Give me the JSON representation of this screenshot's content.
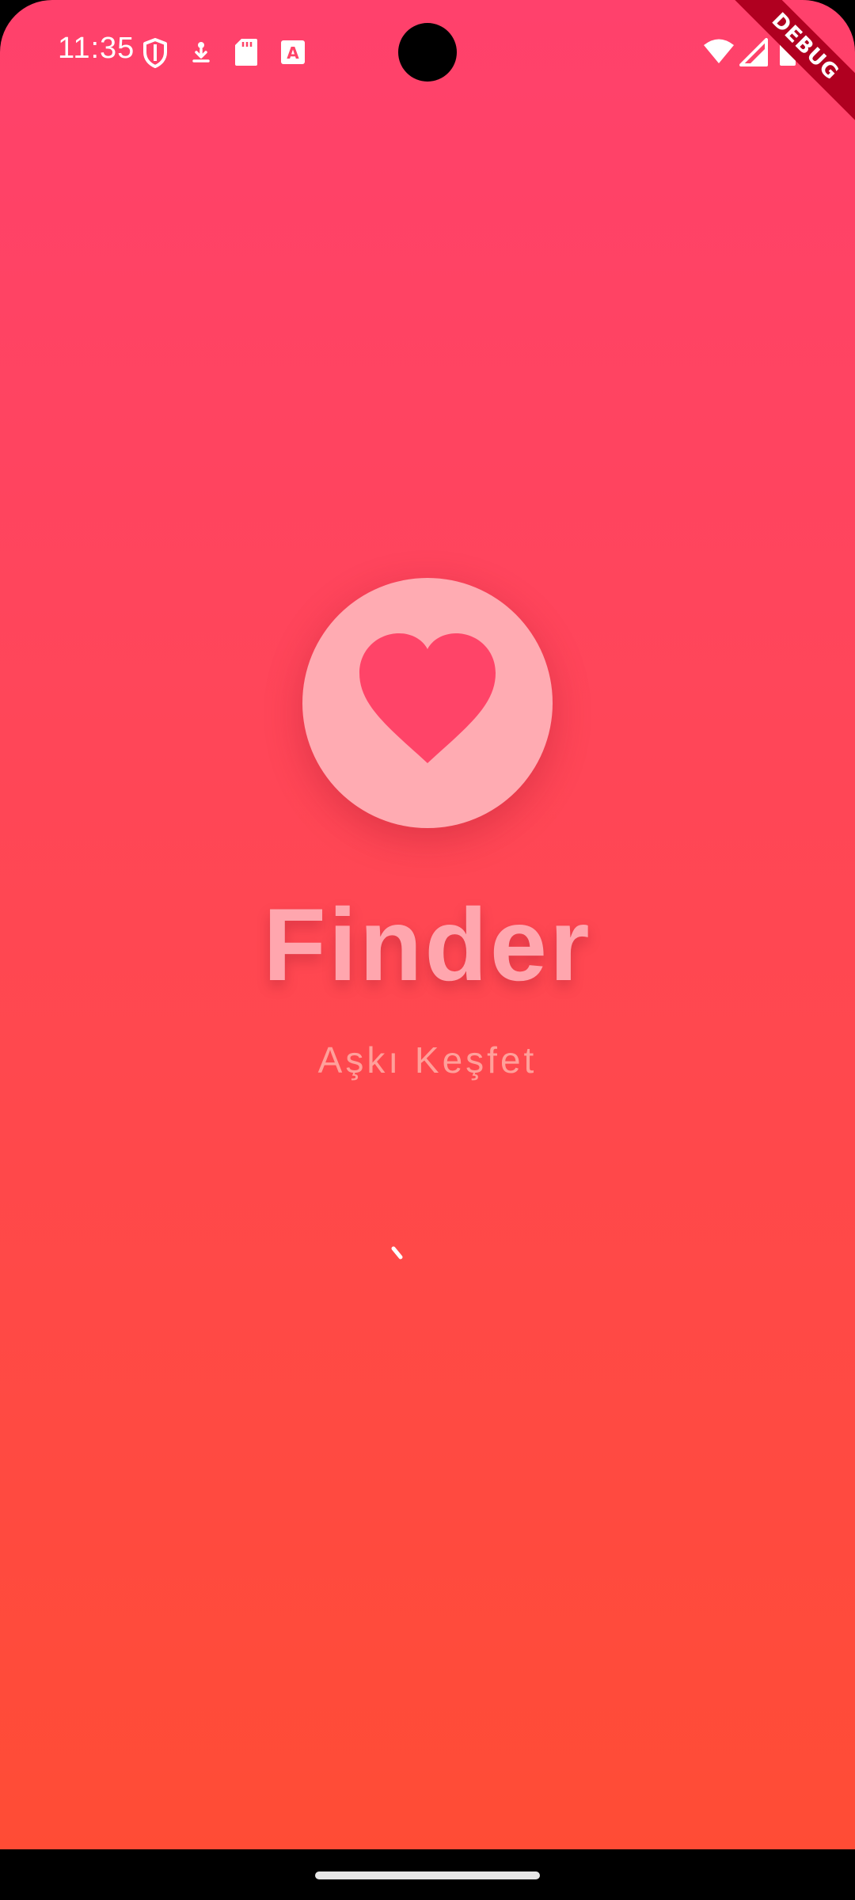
{
  "status_bar": {
    "time": "11:35",
    "left_icons": [
      "shield-icon",
      "download-icon",
      "sd-card-icon",
      "font-a-icon"
    ],
    "right_icons": [
      "wifi-icon",
      "cell-signal-icon",
      "battery-icon"
    ]
  },
  "debug_banner": "DEBUG",
  "splash": {
    "logo_icon": "heart-icon",
    "title": "Finder",
    "subtitle": "Aşkı Keşfet"
  },
  "colors": {
    "gradient_top": "#FF416C",
    "gradient_bottom": "#FF4C35",
    "logo_circle": "#FFABB2",
    "heart": "#FF4468",
    "title": "#FFA6AE",
    "subtitle": "#FFA09A"
  }
}
